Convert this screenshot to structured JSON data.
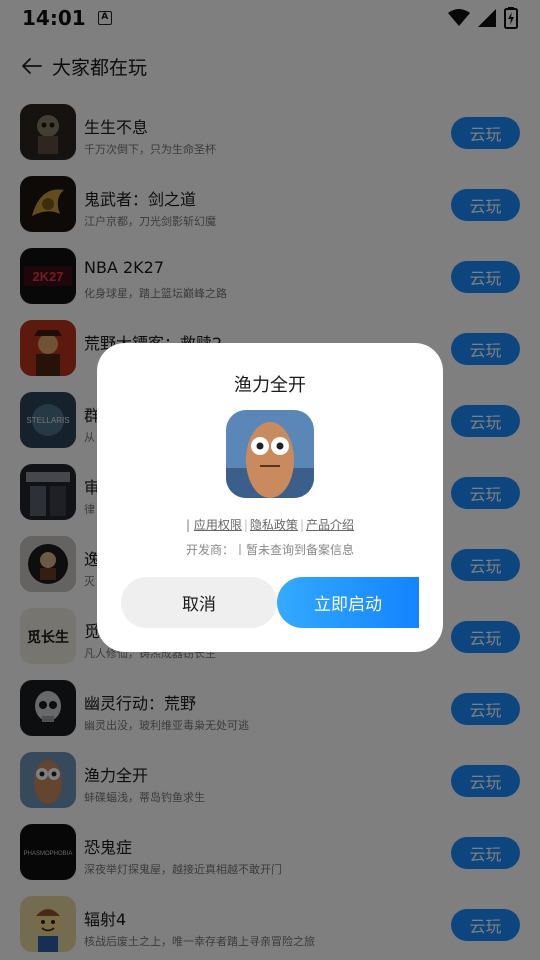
{
  "status": {
    "time": "14:01",
    "a_badge": "A"
  },
  "header": {
    "title": "大家都在玩"
  },
  "games": [
    {
      "title": "生生不息",
      "subtitle": "千万次倒下，只为生命圣杯",
      "button": "云玩"
    },
    {
      "title": "鬼武者：剑之道",
      "subtitle": "江户京都，刀光剑影斩幻魔",
      "button": "云玩"
    },
    {
      "title": "NBA 2K27",
      "subtitle": "化身球星，踏上篮坛巅峰之路",
      "button": "云玩"
    },
    {
      "title": "荒野大镖客：救赎2",
      "subtitle": "",
      "button": "云玩"
    },
    {
      "title": "群",
      "subtitle": "从",
      "button": "云玩"
    },
    {
      "title": "审",
      "subtitle": "律",
      "button": "云玩"
    },
    {
      "title": "逸",
      "subtitle": "灭",
      "button": "云玩"
    },
    {
      "title": "觅",
      "subtitle": "凡人修仙，铸炁成器窃长生",
      "button": "云玩"
    },
    {
      "title": "幽灵行动：荒野",
      "subtitle": "幽灵出没，玻利维亚毒枭无处可逃",
      "button": "云玩"
    },
    {
      "title": "渔力全开",
      "subtitle": "蚌碟蝠浅，蒂岛钓鱼求生",
      "button": "云玩"
    },
    {
      "title": "恐鬼症",
      "subtitle": "深夜举灯探鬼屋，越接近真相越不敢开门",
      "button": "云玩"
    },
    {
      "title": "辐射4",
      "subtitle": "核战后废土之上，唯一幸存者踏上寻亲冒险之旅",
      "button": "云玩"
    }
  ],
  "thumb_texts": {
    "nba": "2K27",
    "stellaris": "STELLARIS",
    "phasmo": "PHASMOPHOBIA",
    "mixian": "觅长生"
  },
  "dialog": {
    "title": "渔力全开",
    "links_prefix": "|",
    "link_permission": "应用权限",
    "link_privacy": "隐私政策",
    "link_intro": "产品介绍",
    "developer": "开发商：丨暂未查询到备案信息",
    "cancel": "取消",
    "launch": "立即启动"
  },
  "colors": {
    "accent": "#1a8dff",
    "overlay": "rgba(0,0,0,0.5)"
  },
  "icons": [
    "back-arrow-icon",
    "wifi-icon",
    "signal-icon",
    "battery-charging-icon"
  ]
}
